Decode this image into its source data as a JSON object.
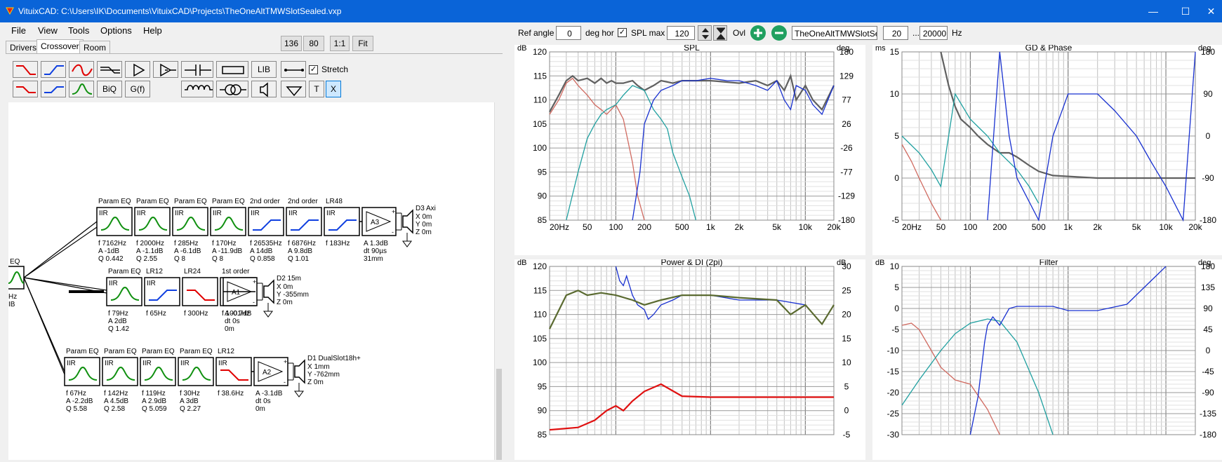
{
  "window": {
    "title": "VituixCAD: C:\\Users\\IK\\Documents\\VituixCAD\\Projects\\TheOneAltTMWSlotSealed.vxp",
    "minimize": "—",
    "maximize": "☐",
    "close": "✕"
  },
  "menu": [
    "File",
    "View",
    "Tools",
    "Options",
    "Help"
  ],
  "tabs": [
    "Drivers",
    "Crossover",
    "Room"
  ],
  "zoom_buttons": [
    "136",
    "80",
    "1:1",
    "Fit"
  ],
  "toolbar": {
    "lib": "LIB",
    "biq": "BiQ",
    "gf": "G(f)",
    "t": "T",
    "x": "X",
    "stretch": "Stretch",
    "stretch_checked": true
  },
  "right_toolbar": {
    "ref_angle_label": "Ref angle",
    "ref_angle": "0",
    "deg_hor": "deg hor",
    "spl_max_label": "SPL max",
    "spl_max": "120",
    "spl_max_checked": true,
    "ovl": "Ovl",
    "file": "TheOneAltTMWSlotSeal",
    "f_low": "20",
    "dots": "...",
    "f_high": "20000",
    "hz": "Hz"
  },
  "crossover": {
    "top": {
      "blocks": [
        {
          "type": "Param EQ",
          "head": "IIR",
          "p": [
            "f   7162Hz",
            "A   -1dB",
            "Q   0.442"
          ]
        },
        {
          "type": "Param EQ",
          "head": "IIR",
          "p": [
            "f   2000Hz",
            "A   -1.1dB",
            "Q   2.55"
          ]
        },
        {
          "type": "Param EQ",
          "head": "IIR",
          "p": [
            "f   285Hz",
            "A   -6.1dB",
            "Q   8"
          ]
        },
        {
          "type": "Param EQ",
          "head": "IIR",
          "p": [
            "f   170Hz",
            "A   -11.9dB",
            "Q   8"
          ]
        },
        {
          "type": "2nd order",
          "head": "IIR",
          "p": [
            "f   26535Hz",
            "A   14dB",
            "Q   0.858"
          ]
        },
        {
          "type": "2nd order",
          "head": "IIR",
          "p": [
            "f   6876Hz",
            "A   9.8dB",
            "Q   1.01"
          ]
        },
        {
          "type": "LR48",
          "head": "IIR",
          "p": [
            "f   183Hz"
          ]
        }
      ],
      "amp": {
        "name": "A3",
        "p": [
          "A  1.3dB",
          "dt  90µs",
          "31mm"
        ]
      },
      "driver": {
        "name": "D3 Axi",
        "p": [
          "X   0m",
          "Y   0m",
          "Z   0m"
        ]
      }
    },
    "mid": {
      "blocks": [
        {
          "type": "Param EQ",
          "head": "IIR",
          "p": [
            "f   79Hz",
            "A   2dB",
            "Q   1.42"
          ]
        },
        {
          "type": "LR12",
          "head": "IIR",
          "p": [
            "f   65Hz"
          ]
        },
        {
          "type": "LR24",
          "head": "",
          "p": [
            "f   300Hz"
          ]
        },
        {
          "type": "1st order",
          "head": "IIR",
          "p": [
            "f   1001Hz"
          ]
        }
      ],
      "amp": {
        "name": "A1",
        "p": [
          "A  -0.7dB",
          "dt 0s",
          "0m"
        ]
      },
      "driver": {
        "name": "D2 15m",
        "p": [
          "X   0m",
          "Y   -355mm",
          "Z   0m"
        ]
      }
    },
    "bot": {
      "blocks": [
        {
          "type": "Param EQ",
          "head": "IIR",
          "p": [
            "f   67Hz",
            "A   -2.2dB",
            "Q   5.58"
          ]
        },
        {
          "type": "Param EQ",
          "head": "IIR",
          "p": [
            "f   142Hz",
            "A   4.5dB",
            "Q   2.58"
          ]
        },
        {
          "type": "Param EQ",
          "head": "IIR",
          "p": [
            "f   119Hz",
            "A   2.9dB",
            "Q   5.059"
          ]
        },
        {
          "type": "Param EQ",
          "head": "IIR",
          "p": [
            "f   30Hz",
            "A   3dB",
            "Q   2.27"
          ]
        },
        {
          "type": "LR12",
          "head": "IIR",
          "p": [
            "f   38.6Hz"
          ]
        }
      ],
      "amp": {
        "name": "A2",
        "p": [
          "A  -3.1dB",
          "dt 0s",
          "0m"
        ]
      },
      "driver": {
        "name": "D1 DualSlot18h+",
        "p": [
          "X   1mm",
          "Y   -762mm",
          "Z   0m"
        ]
      }
    },
    "input": {
      "label": "EQ",
      "p": [
        "Hz",
        "IB"
      ]
    }
  },
  "chart_data": [
    {
      "type": "line",
      "title": "SPL",
      "ylabel": "dB",
      "y2label": "deg",
      "ylim": [
        85,
        120
      ],
      "y2lim": [
        -180,
        180
      ],
      "yticks": [
        "120",
        "115",
        "110",
        "105",
        "100",
        "95",
        "90",
        "85"
      ],
      "y2ticks": [
        "180",
        "129",
        "77",
        "26",
        "-26",
        "-77",
        "-129",
        "-180"
      ],
      "xticks": [
        "20Hz",
        "50",
        "100",
        "200",
        "500",
        "1k",
        "2k",
        "5k",
        "10k",
        "20k"
      ],
      "xscale": "log",
      "xlim": [
        20,
        20000
      ],
      "series": [
        {
          "color": "#606060",
          "x": [
            20,
            25,
            30,
            35,
            40,
            50,
            60,
            70,
            80,
            90,
            100,
            120,
            150,
            170,
            200,
            250,
            300,
            400,
            500,
            700,
            1000,
            2000,
            3000,
            4000,
            5000,
            6000,
            7000,
            8000,
            10000,
            12000,
            15000,
            20000
          ],
          "y": [
            107.5,
            111,
            114,
            115,
            114,
            114.5,
            113.5,
            114.5,
            113.5,
            114,
            113.5,
            113.5,
            114,
            113,
            112,
            113,
            114,
            113.5,
            114,
            114,
            114,
            113.5,
            114,
            113,
            114,
            112,
            115,
            110,
            113,
            110,
            108,
            113
          ]
        },
        {
          "color": "#d06a60",
          "x": [
            20,
            25,
            30,
            35,
            40,
            50,
            60,
            70,
            80,
            100,
            120,
            150,
            170,
            200
          ],
          "y": [
            107,
            110,
            113.5,
            114.5,
            113,
            111,
            109,
            108,
            107,
            109,
            106,
            97,
            90,
            85
          ]
        },
        {
          "color": "#20a0a0",
          "x": [
            30,
            40,
            50,
            60,
            70,
            80,
            100,
            120,
            150,
            200,
            250,
            300,
            350,
            400,
            500,
            600,
            700
          ],
          "y": [
            85,
            95,
            102,
            105,
            107,
            108,
            109,
            111,
            113,
            112,
            108,
            106,
            104,
            99,
            94,
            90,
            85
          ]
        },
        {
          "color": "#1830d0",
          "x": [
            150,
            180,
            200,
            250,
            300,
            400,
            500,
            700,
            1000,
            1500,
            2000,
            3000,
            4000,
            5000,
            6000,
            7000,
            8000,
            10000,
            12000,
            15000,
            20000
          ],
          "y": [
            85,
            95,
            105,
            110,
            112,
            113,
            114,
            114,
            114.5,
            114,
            114,
            113,
            112,
            114,
            110,
            108,
            113,
            112,
            109,
            107,
            113
          ]
        }
      ]
    },
    {
      "type": "line",
      "title": "GD & Phase",
      "ylabel": "ms",
      "y2label": "deg",
      "ylim": [
        -5,
        15
      ],
      "y2lim": [
        -180,
        180
      ],
      "yticks": [
        "15",
        "10",
        "5",
        "0",
        "-5"
      ],
      "y2ticks": [
        "180",
        "90",
        "0",
        "-90",
        "-180"
      ],
      "xticks": [
        "20Hz",
        "50",
        "100",
        "200",
        "500",
        "1k",
        "2k",
        "5k",
        "10k",
        "20k"
      ],
      "xscale": "log",
      "xlim": [
        20,
        20000
      ],
      "series": [
        {
          "color": "#606060",
          "x": [
            50,
            60,
            70,
            80,
            100,
            120,
            150,
            200,
            250,
            300,
            400,
            500,
            700,
            1000,
            2000,
            5000,
            10000,
            20000
          ],
          "y": [
            15,
            11,
            8.5,
            7,
            6,
            5,
            4,
            3,
            3,
            2.5,
            1.5,
            0.8,
            0.3,
            0.2,
            0,
            0,
            0,
            0
          ]
        },
        {
          "color": "#d06a60",
          "x": [
            20,
            25,
            30,
            40,
            50
          ],
          "y": [
            4,
            2,
            0,
            -3,
            -5
          ]
        },
        {
          "color": "#20a0a0",
          "x": [
            20,
            30,
            40,
            50,
            70,
            100,
            150,
            200,
            300,
            400,
            500
          ],
          "y": [
            5,
            3,
            1,
            -1,
            10,
            7,
            5,
            3,
            1,
            -1,
            -3
          ]
        },
        {
          "color": "#1830d0",
          "x": [
            150,
            200,
            250,
            300,
            500,
            700,
            1000,
            2000,
            3000,
            5000,
            7000,
            10000,
            15000,
            20000
          ],
          "y": [
            -5,
            15,
            5,
            0,
            -5,
            5,
            10,
            10,
            8,
            5,
            2,
            -1,
            -5,
            15
          ]
        }
      ]
    },
    {
      "type": "line",
      "title": "Power & DI (2pi)",
      "ylabel": "dB",
      "y2label": "dB",
      "ylim": [
        85,
        120
      ],
      "y2lim": [
        -5,
        30
      ],
      "yticks": [
        "120",
        "115",
        "110",
        "105",
        "100",
        "95",
        "90",
        "85"
      ],
      "y2ticks": [
        "30",
        "25",
        "20",
        "15",
        "10",
        "5",
        "0",
        "-5"
      ],
      "xticks": [],
      "xscale": "log",
      "xlim": [
        20,
        20000
      ],
      "series": [
        {
          "color": "#1830d0",
          "x": [
            100,
            110,
            120,
            130,
            150,
            170,
            200,
            220,
            250,
            300,
            400,
            500,
            700,
            1000,
            2000,
            5000,
            10000
          ],
          "y": [
            120,
            117,
            116,
            118,
            114,
            112,
            111,
            109,
            110,
            112,
            113,
            114,
            114,
            114,
            113,
            113,
            112
          ]
        },
        {
          "color": "#5a6a30",
          "x": [
            20,
            30,
            40,
            50,
            70,
            100,
            150,
            200,
            300,
            500,
            1000,
            2000,
            5000,
            7000,
            10000,
            15000,
            20000
          ],
          "y": [
            107,
            114,
            115,
            114,
            114.5,
            114,
            113,
            112,
            113,
            114,
            114,
            113.5,
            113,
            110,
            112,
            108,
            112
          ]
        },
        {
          "color": "#e01010",
          "x": [
            20,
            40,
            60,
            80,
            100,
            120,
            150,
            200,
            300,
            500,
            1000,
            2000,
            5000,
            20000
          ],
          "y": [
            86,
            86.5,
            88,
            90,
            91,
            90,
            92,
            94,
            95.5,
            93,
            92.8,
            92.8,
            92.8,
            92.8
          ]
        }
      ]
    },
    {
      "type": "line",
      "title": "Filter",
      "ylabel": "dB",
      "y2label": "deg",
      "ylim": [
        -30,
        10
      ],
      "y2lim": [
        -180,
        180
      ],
      "yticks": [
        "10",
        "5",
        "0",
        "-5",
        "-10",
        "-15",
        "-20",
        "-25",
        "-30"
      ],
      "y2ticks": [
        "180",
        "135",
        "90",
        "45",
        "0",
        "-45",
        "-90",
        "-135",
        "-180"
      ],
      "xticks": [],
      "xscale": "log",
      "xlim": [
        20,
        20000
      ],
      "series": [
        {
          "color": "#d06a60",
          "x": [
            20,
            25,
            30,
            40,
            50,
            70,
            100,
            150,
            200
          ],
          "y": [
            -4,
            -3.5,
            -5,
            -10,
            -14,
            -17,
            -18,
            -24,
            -30
          ]
        },
        {
          "color": "#20a0a0",
          "x": [
            20,
            30,
            50,
            70,
            100,
            150,
            200,
            300,
            500,
            700
          ],
          "y": [
            -23,
            -17,
            -10,
            -6,
            -3.5,
            -2.5,
            -3,
            -8,
            -20,
            -30
          ]
        },
        {
          "color": "#1830d0",
          "x": [
            100,
            120,
            140,
            150,
            170,
            200,
            250,
            300,
            400,
            500,
            700,
            1000,
            2000,
            4000,
            6000,
            10000
          ],
          "y": [
            -30,
            -21,
            -8,
            -4,
            -2,
            -4,
            0,
            0.5,
            0.5,
            0.5,
            0.5,
            -0.5,
            -0.5,
            1,
            5,
            10
          ]
        }
      ]
    }
  ]
}
